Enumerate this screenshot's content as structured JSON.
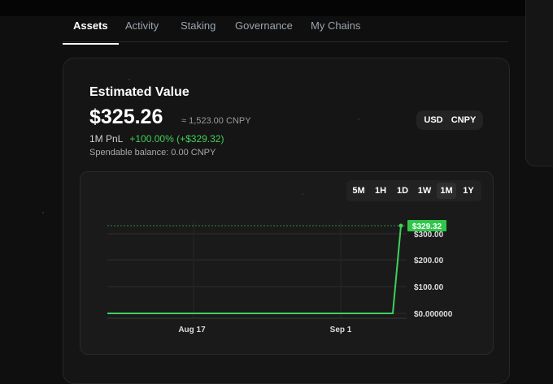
{
  "tabs": [
    {
      "label": "Assets",
      "active": true
    },
    {
      "label": "Activity",
      "active": false
    },
    {
      "label": "Staking",
      "active": false
    },
    {
      "label": "Governance",
      "active": false
    },
    {
      "label": "My Chains",
      "active": false
    }
  ],
  "card": {
    "title": "Estimated Value",
    "value": "$325.26",
    "approx": "≈ 1,523.00 CNPY",
    "pnl_label": "1M PnL",
    "pnl_value": "+100.00% (+$329.32)",
    "spendable": "Spendable balance: 0.00 CNPY",
    "currency_options": [
      "USD",
      "CNPY"
    ]
  },
  "ranges": [
    "5M",
    "1H",
    "1D",
    "1W",
    "1M",
    "1Y"
  ],
  "selected_range": "1M",
  "colors": {
    "line": "#3fd05a",
    "label_bg": "#2fc64a"
  },
  "chart_data": {
    "type": "line",
    "x_tick_labels": [
      "Aug 17",
      "Sep 1"
    ],
    "y_tick_labels": [
      "$300.00",
      "$200.00",
      "$100.00",
      "$0.000000"
    ],
    "ylim": [
      0,
      330
    ],
    "last_value_label": "$329.32",
    "series": [
      {
        "x": [
          "Aug 7",
          "Aug 10",
          "Aug 13",
          "Aug 16",
          "Aug 19",
          "Aug 22",
          "Aug 25",
          "Aug 28",
          "Aug 31",
          "Sep 3",
          "Sep 6",
          "Sep 7"
        ],
        "values": [
          0,
          0,
          0,
          0,
          0,
          0,
          0,
          0,
          0,
          0,
          0,
          329.32
        ]
      }
    ],
    "grid": true
  }
}
